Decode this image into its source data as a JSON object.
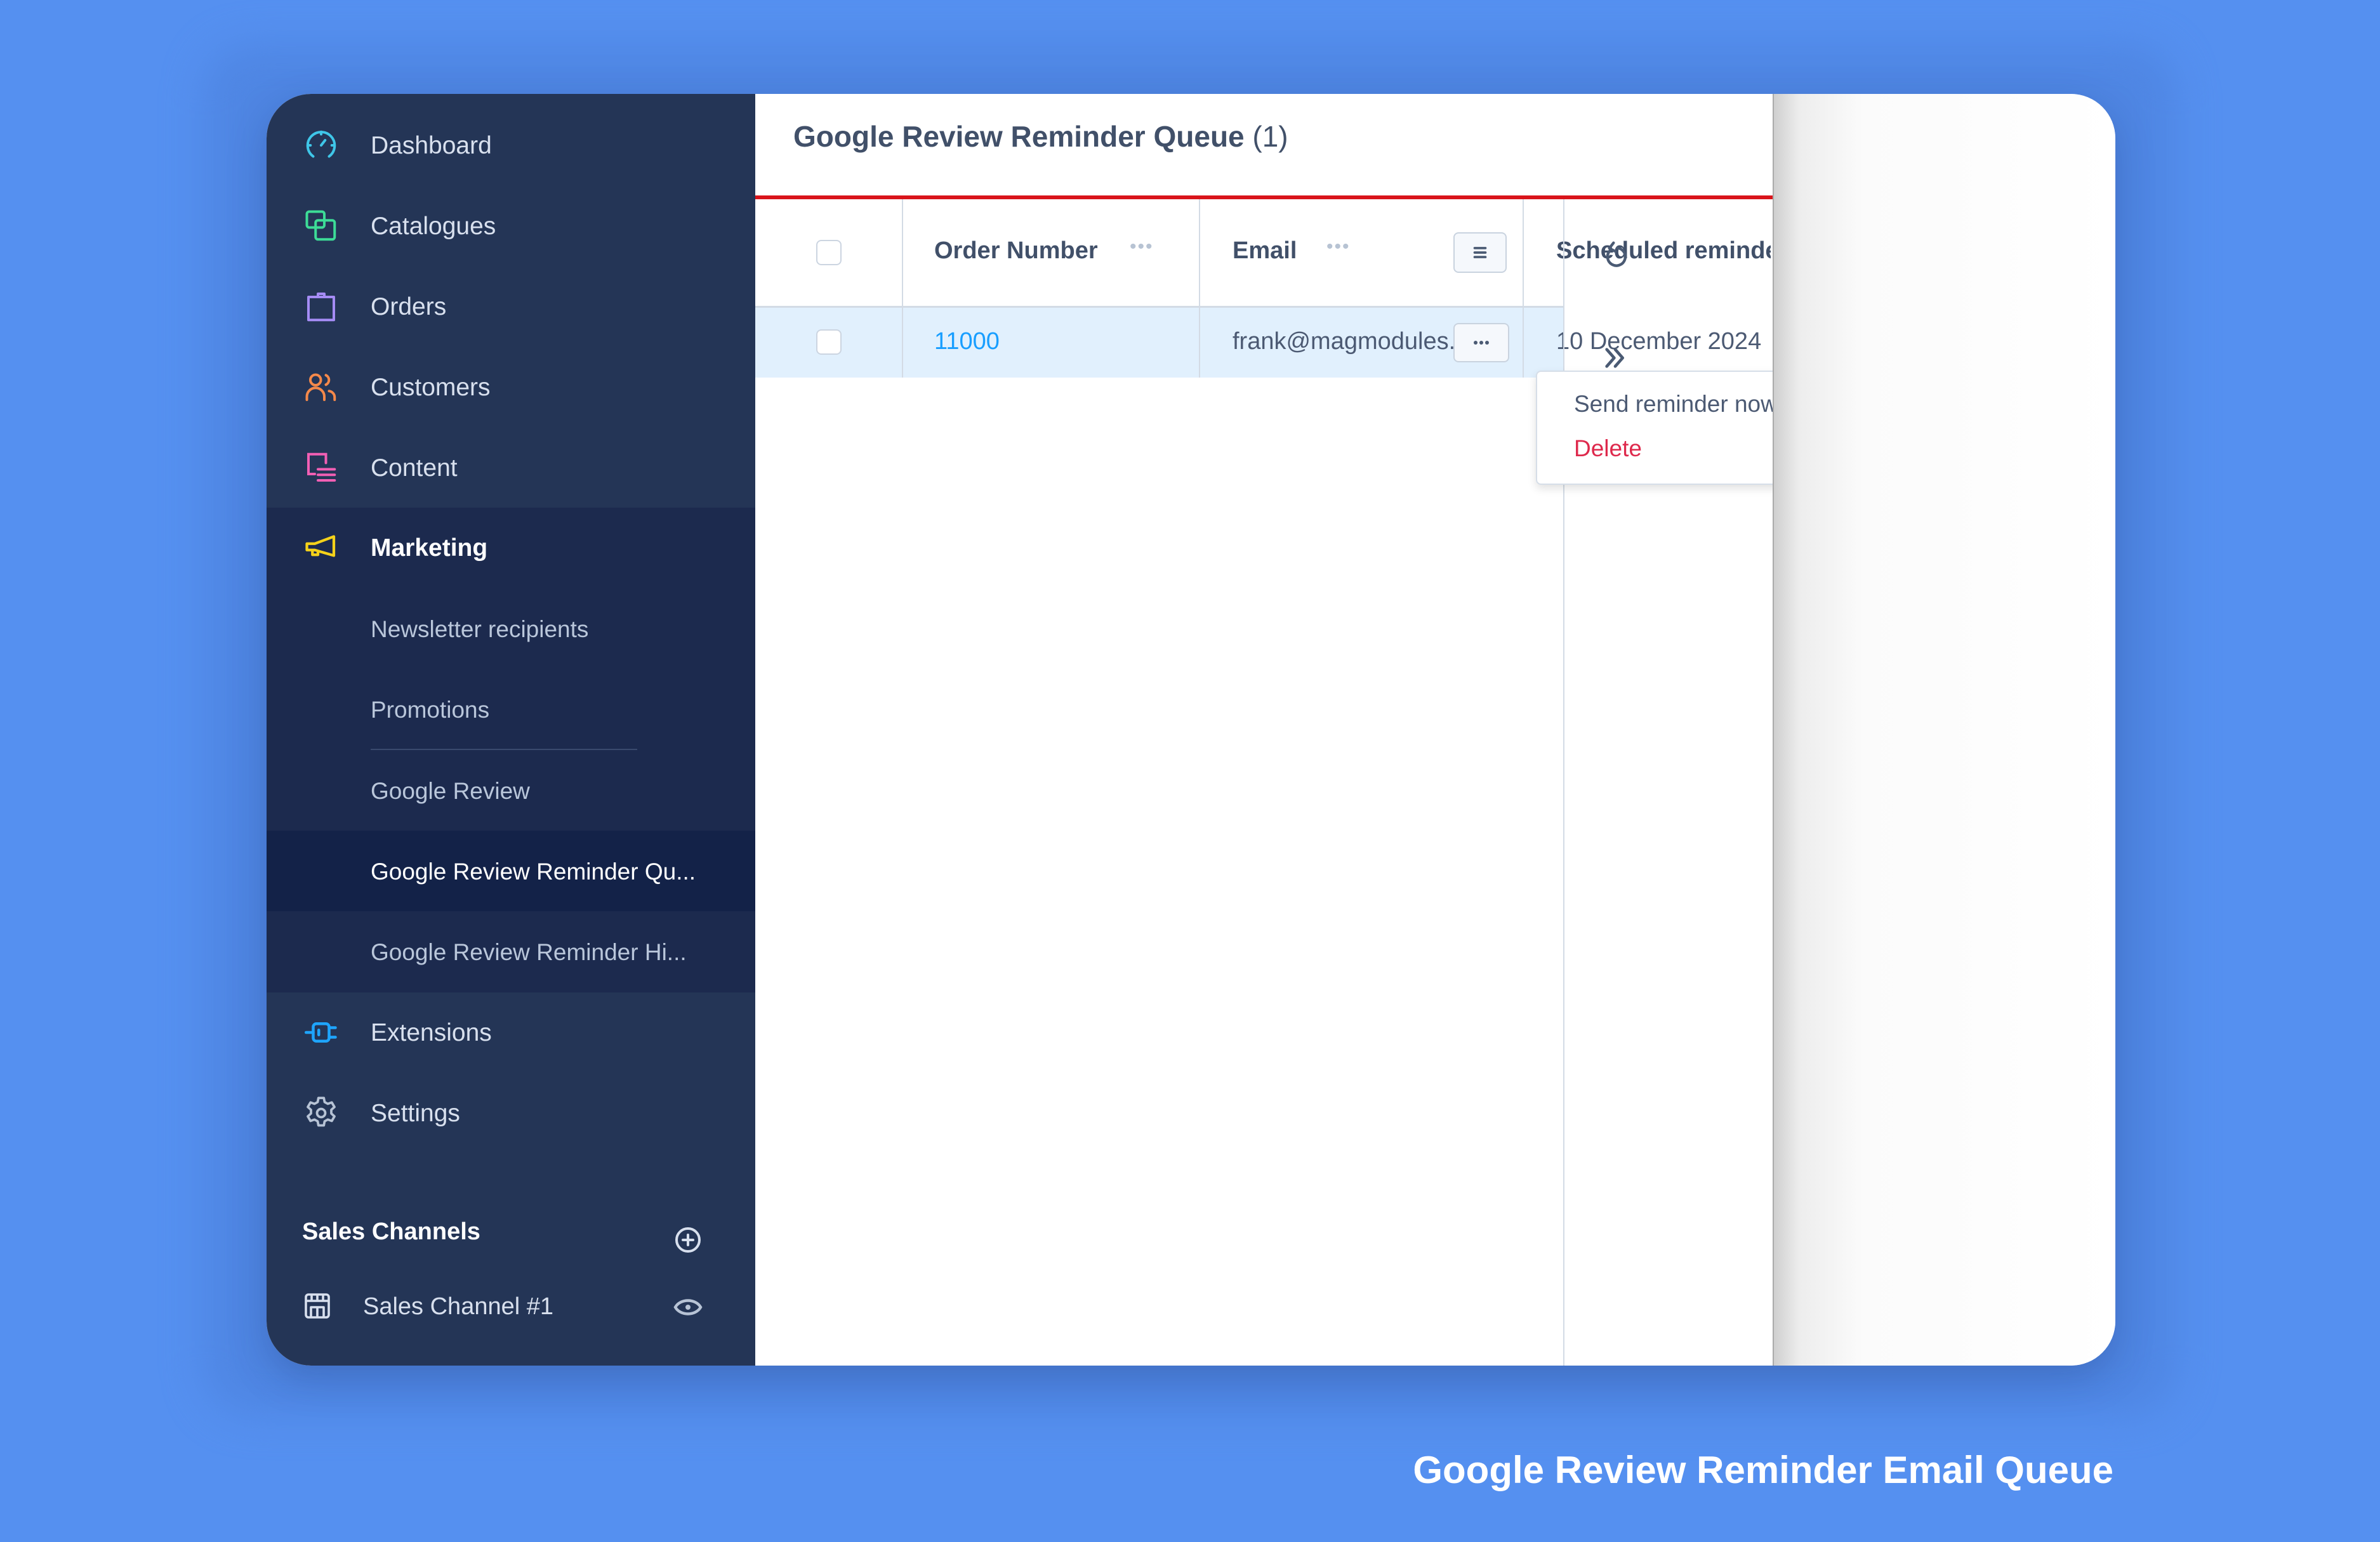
{
  "sidebar": {
    "items": [
      {
        "label": "Dashboard",
        "icon": "dashboard-gauge-icon",
        "color": "#3fc6e8"
      },
      {
        "label": "Catalogues",
        "icon": "catalogues-icon",
        "color": "#3ddc97"
      },
      {
        "label": "Orders",
        "icon": "shopping-bag-icon",
        "color": "#a58cf5"
      },
      {
        "label": "Customers",
        "icon": "customers-icon",
        "color": "#f5894a"
      },
      {
        "label": "Content",
        "icon": "content-icon",
        "color": "#f25fb4"
      },
      {
        "label": "Marketing",
        "icon": "megaphone-icon",
        "color": "#f5d21a"
      },
      {
        "label": "Extensions",
        "icon": "plug-icon",
        "color": "#1ea5ff"
      },
      {
        "label": "Settings",
        "icon": "gear-icon",
        "color": "#b7c3d5"
      }
    ],
    "marketing_subitems": [
      {
        "label": "Newsletter recipients"
      },
      {
        "label": "Promotions"
      },
      {
        "label": "Google Review"
      },
      {
        "label": "Google Review Reminder Qu..."
      },
      {
        "label": "Google Review Reminder Hi..."
      }
    ],
    "active_subitem": "Google Review Reminder Qu...",
    "sales_channels": {
      "header": "Sales Channels",
      "channels": [
        {
          "label": "Sales Channel #1"
        }
      ]
    }
  },
  "main": {
    "title": "Google Review Reminder Queue",
    "count": "(1)",
    "table": {
      "columns": [
        "Order Number",
        "Email",
        "Scheduled reminde"
      ],
      "rows": [
        {
          "order_number": "11000",
          "email": "frank@magmodules.eu",
          "scheduled": "10 December 2024"
        }
      ]
    },
    "context_menu": {
      "items": [
        {
          "label": "Send reminder now",
          "color": "#4c5a73"
        },
        {
          "label": "Delete",
          "color": "#de294c"
        }
      ]
    }
  },
  "caption": "Google Review Reminder Email Queue",
  "colors": {
    "accent_red_line": "#d9141b",
    "link_blue": "#189eff",
    "sidebar_bg": "#243556",
    "selected_row": "#e1f0fd"
  }
}
